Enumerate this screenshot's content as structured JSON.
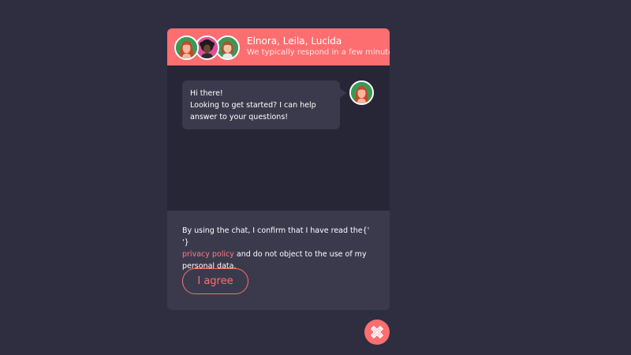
{
  "header": {
    "agent_names": "Elnora, Leila, Lucida",
    "subtitle": "We typically respond in a few minutes",
    "accent_color": "#fd6e70",
    "avatars": [
      "agent-elnora-avatar",
      "agent-leila-avatar",
      "agent-lucida-avatar"
    ]
  },
  "message": {
    "line1": "Hi there!",
    "line2": "Looking to get started? I can help",
    "line3": "answer to your questions!"
  },
  "consent": {
    "text_before": "By using the chat, I confirm that I have read the{' '}",
    "link_label": "privacy policy",
    "text_after": " and do not object to the use of my personal data.",
    "agree_label": "I agree"
  },
  "close_button": {
    "icon": "close-icon"
  }
}
